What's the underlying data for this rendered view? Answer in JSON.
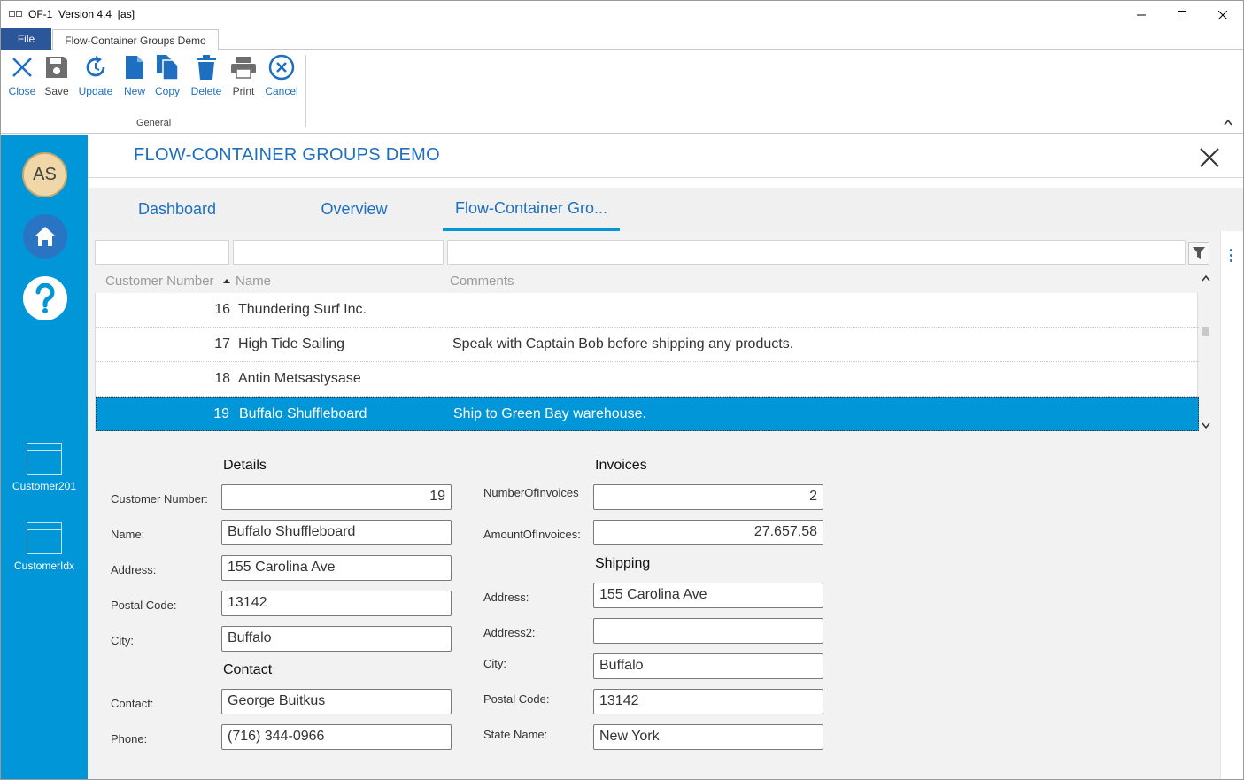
{
  "window": {
    "title": "OF-1  Version 4.4  [as]"
  },
  "menu": {
    "file_label": "File",
    "ribbon_tab": "Flow-Container Groups Demo"
  },
  "ribbon": {
    "buttons": [
      {
        "label": "Close",
        "icon": "close-icon"
      },
      {
        "label": "Save",
        "icon": "save-icon"
      },
      {
        "label": "Update",
        "icon": "refresh-icon"
      },
      {
        "label": "New",
        "icon": "new-document-icon"
      },
      {
        "label": "Copy",
        "icon": "copy-icon"
      },
      {
        "label": "Delete",
        "icon": "trash-icon"
      },
      {
        "label": "Print",
        "icon": "printer-icon"
      },
      {
        "label": "Cancel",
        "icon": "cancel-icon"
      }
    ],
    "group_label": "General"
  },
  "sidebar": {
    "avatar_initials": "AS",
    "items": [
      {
        "label": "Customer201",
        "icon": "window-icon"
      },
      {
        "label": "CustomerIdx",
        "icon": "window-icon"
      }
    ],
    "colors": {
      "background": "#0096d8",
      "home": "#2a74c4"
    }
  },
  "page": {
    "title": "FLOW-CONTAINER GROUPS DEMO",
    "tabs": [
      {
        "label": "Dashboard"
      },
      {
        "label": "Overview"
      },
      {
        "label": "Flow-Container Gro..."
      }
    ],
    "active_tab": 2
  },
  "grid": {
    "columns": [
      "Customer Number",
      "Name",
      "Comments"
    ],
    "sort_column": "Customer Number",
    "rows": [
      {
        "num": "16",
        "name": "Thundering Surf Inc.",
        "comments": ""
      },
      {
        "num": "17",
        "name": "High Tide Sailing",
        "comments": "Speak with Captain Bob before shipping any products."
      },
      {
        "num": "18",
        "name": "Antin Metsastysase",
        "comments": ""
      },
      {
        "num": "19",
        "name": "Buffalo Shuffleboard",
        "comments": "Ship to Green Bay warehouse."
      }
    ],
    "selected_row": 3
  },
  "details": {
    "title": "Details",
    "customer_number_label": "Customer Number:",
    "customer_number": "19",
    "name_label": "Name:",
    "name": "Buffalo Shuffleboard",
    "address_label": "Address:",
    "address": "155 Carolina Ave",
    "postal_code_label": "Postal Code:",
    "postal_code": "13142",
    "city_label": "City:",
    "city": "Buffalo"
  },
  "contact": {
    "title": "Contact",
    "contact_label": "Contact:",
    "contact": "George Buitkus",
    "phone_label": "Phone:",
    "phone": "(716) 344-0966"
  },
  "invoices": {
    "title": "Invoices",
    "count_label": "NumberOfInvoices",
    "count": "2",
    "amount_label": "AmountOfInvoices:",
    "amount": "27.657,58"
  },
  "shipping": {
    "title": "Shipping",
    "address_label": "Address:",
    "address": "155 Carolina Ave",
    "address2_label": "Address2:",
    "address2": "",
    "city_label": "City:",
    "city": "Buffalo",
    "postal_code_label": "Postal Code:",
    "postal_code": "13142",
    "state_label": "State Name:",
    "state": "New York"
  }
}
